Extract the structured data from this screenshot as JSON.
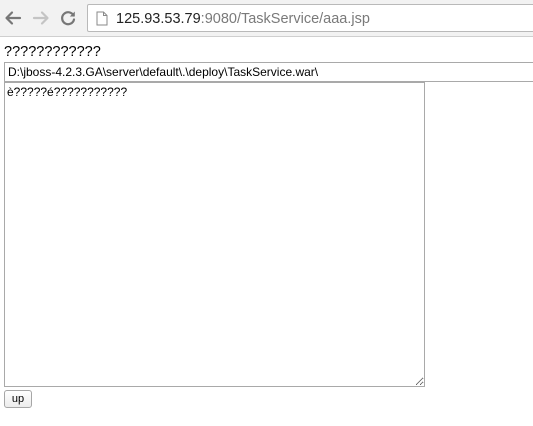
{
  "browser": {
    "url_host": "125.93.53.79",
    "url_rest": ":9080/TaskService/aaa.jsp",
    "icons": {
      "back": "back-arrow-icon",
      "forward": "forward-arrow-icon",
      "reload": "reload-icon",
      "page": "page-icon"
    }
  },
  "page": {
    "heading": "????????????",
    "path_value": "D:\\jboss-4.2.3.GA\\server\\default\\.\\deploy\\TaskService.war\\",
    "textarea_value": "è?????é???????????",
    "up_button_label": "up"
  }
}
